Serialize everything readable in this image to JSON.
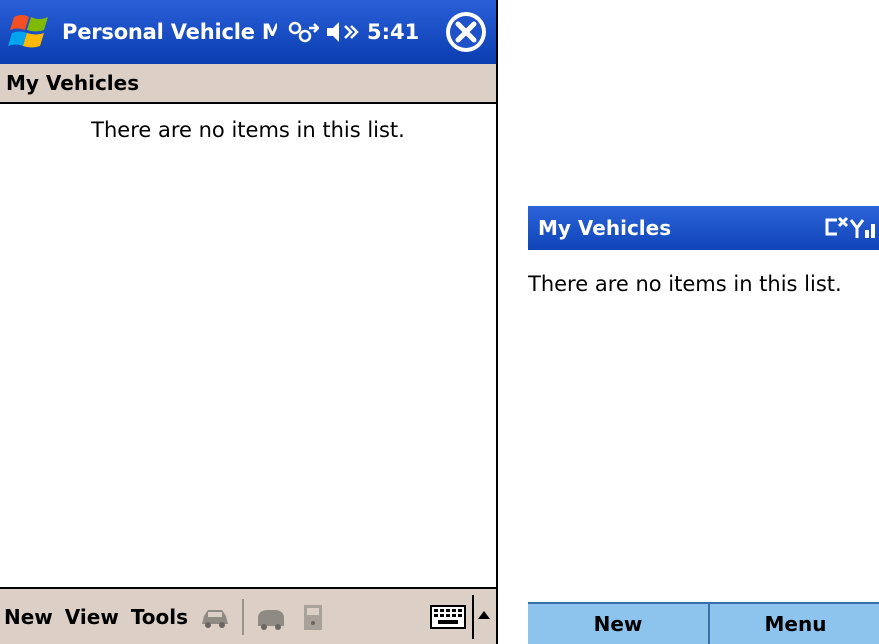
{
  "pocket_pc": {
    "app_title": "Personal Vehicle Ma",
    "time": "5:41",
    "header_title": "My Vehicles",
    "empty_message": "There are no items in this list.",
    "menu": [
      "New",
      "View",
      "Tools"
    ],
    "icons": {
      "start": "windows-start-flag-icon",
      "connectivity": "connectivity-icon",
      "volume": "volume-icon",
      "close": "close-icon",
      "toolbar": [
        "car-icon",
        "vehicle-icon",
        "fuel-pump-icon"
      ],
      "keyboard": "keyboard-icon",
      "sip_arrow": "chevron-up-icon"
    },
    "colors": {
      "title_bar": "#1f52c8",
      "header_bar": "#dcd0c6"
    }
  },
  "smartphone": {
    "title": "My Vehicles",
    "empty_message": "There are no items in this list.",
    "softkeys": {
      "left": "New",
      "right": "Menu"
    },
    "icons": {
      "status": "signal-status-icon"
    },
    "colors": {
      "title_bar": "#1f52c8",
      "softkey_bar": "#8cc4ee"
    }
  }
}
